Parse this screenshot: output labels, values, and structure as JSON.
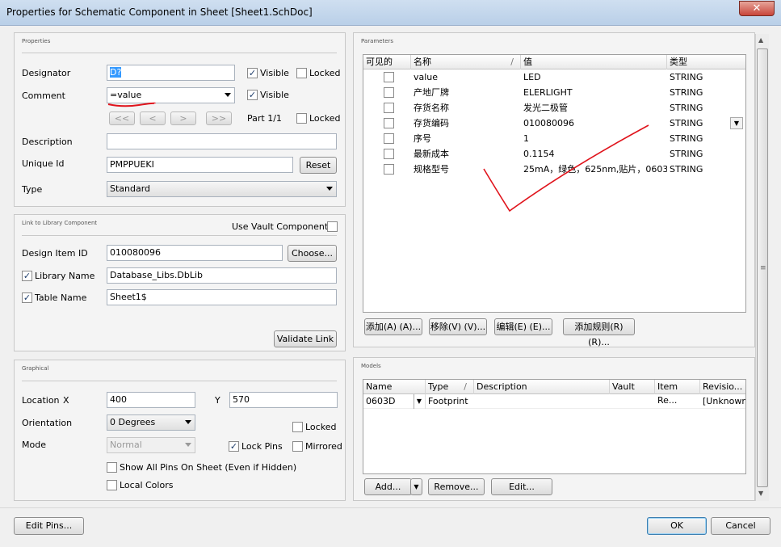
{
  "window": {
    "title": "Properties for Schematic Component in Sheet [Sheet1.SchDoc]",
    "close_glyph": "✕"
  },
  "properties": {
    "title": "Properties",
    "designator_label": "Designator",
    "designator_value": "D?",
    "visible_label": "Visible",
    "locked_label": "Locked",
    "comment_label": "Comment",
    "comment_value": "=value",
    "part_nav": [
      "<<",
      "<",
      ">",
      ">>"
    ],
    "part_label": "Part 1/1",
    "description_label": "Description",
    "description_value": "",
    "unique_id_label": "Unique Id",
    "unique_id_value": "PMPPUEKI",
    "reset_label": "Reset",
    "type_label": "Type",
    "type_value": "Standard"
  },
  "library": {
    "title": "Link to Library Component",
    "use_vault_label": "Use Vault Component",
    "design_item_label": "Design Item ID",
    "design_item_value": "010080096",
    "choose_label": "Choose...",
    "library_name_label": "Library Name",
    "library_name_value": "Database_Libs.DbLib",
    "table_name_label": "Table Name",
    "table_name_value": "Sheet1$",
    "validate_label": "Validate Link"
  },
  "graphical": {
    "title": "Graphical",
    "location_label": "Location",
    "x_label": "X",
    "x_value": "400",
    "y_label": "Y",
    "y_value": "570",
    "orientation_label": "Orientation",
    "orientation_value": "0 Degrees",
    "locked_label": "Locked",
    "mode_label": "Mode",
    "mode_value": "Normal",
    "lock_pins_label": "Lock Pins",
    "mirrored_label": "Mirrored",
    "show_pins_label": "Show All Pins On Sheet (Even if Hidden)",
    "local_colors_label": "Local Colors"
  },
  "parameters": {
    "title": "Parameters",
    "headers": [
      "可见的",
      "名称",
      "值",
      "类型"
    ],
    "rows": [
      {
        "name": "value",
        "value": "LED",
        "type": "STRING"
      },
      {
        "name": "产地厂牌",
        "value": "ELERLIGHT",
        "type": "STRING"
      },
      {
        "name": "存货名称",
        "value": "发光二极管",
        "type": "STRING"
      },
      {
        "name": "存货编码",
        "value": "010080096",
        "type": "STRING"
      },
      {
        "name": "序号",
        "value": "1",
        "type": "STRING"
      },
      {
        "name": "最新成本",
        "value": "0.1154",
        "type": "STRING"
      },
      {
        "name": "规格型号",
        "value": "25mA，绿色，625nm,贴片，0603",
        "type": "STRING"
      }
    ],
    "buttons": [
      "添加(A) (A)...",
      "移除(V) (V)...",
      "编辑(E) (E)...",
      "添加规则(R) (R)..."
    ]
  },
  "models": {
    "title": "Models",
    "headers": [
      "Name",
      "Type",
      "Description",
      "Vault",
      "Item Re...",
      "Revisio..."
    ],
    "row": {
      "name": "0603D",
      "type": "Footprint",
      "description": "",
      "vault": "",
      "item": "",
      "revision": "[Unknowr"
    },
    "buttons": {
      "add": "Add...",
      "remove": "Remove...",
      "edit": "Edit..."
    }
  },
  "footer": {
    "edit_pins": "Edit Pins...",
    "ok": "OK",
    "cancel": "Cancel"
  },
  "colors": {
    "annotation": "#e0141c",
    "accent": "#3399ff"
  }
}
